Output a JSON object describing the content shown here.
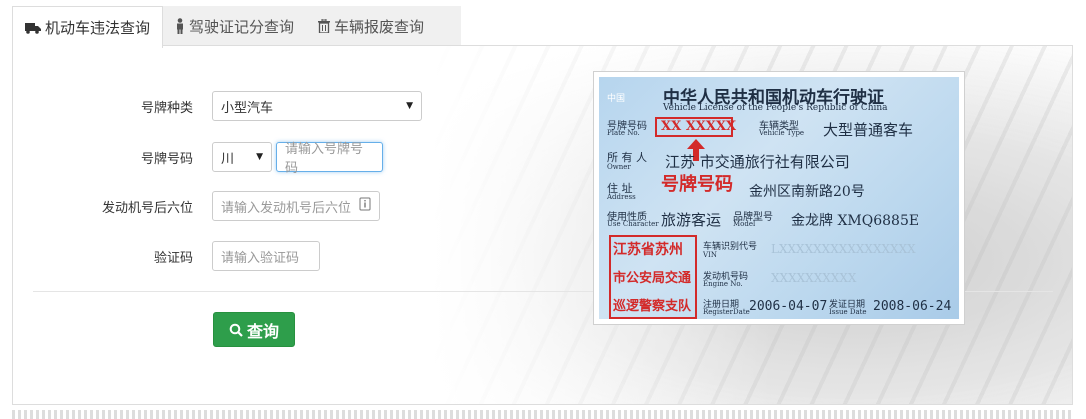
{
  "tabs": [
    {
      "label": "机动车违法查询",
      "icon": "truck-icon",
      "active": true
    },
    {
      "label": "驾驶证记分查询",
      "icon": "person-icon",
      "active": false
    },
    {
      "label": "车辆报废查询",
      "icon": "trash-icon",
      "active": false
    }
  ],
  "form": {
    "plate_type": {
      "label": "号牌种类",
      "value": "小型汽车"
    },
    "plate_number": {
      "label": "号牌号码",
      "province": "川",
      "placeholder": "请输入号牌号码"
    },
    "engine": {
      "label": "发动机号后六位",
      "placeholder": "请输入发动机号后六位"
    },
    "captcha": {
      "label": "验证码",
      "placeholder": "请输入验证码"
    },
    "submit_label": "查询"
  },
  "license": {
    "country": "中国",
    "title_cn": "中华人民共和国机动车行驶证",
    "title_en": "Vehicle License of the People's Republic of China",
    "plate_label": "号牌号码",
    "plate_label_en": "Plate No.",
    "plate_value": "XX XXXXX",
    "vehicle_type_label": "车辆类型",
    "vehicle_type_en": "Vehicle Type",
    "vehicle_type": "大型普通客车",
    "owner_label": "所 有 人",
    "owner_en": "Owner",
    "owner_value": "江苏 市交通旅行社有限公司",
    "address_label": "住 址",
    "address_en": "Address",
    "address_value": "金州区南新路20号",
    "use_label": "使用性质",
    "use_en": "Use Character",
    "use_value": "旅游客运",
    "model_label": "品牌型号",
    "model_en": "Model",
    "model_value": "金龙牌 XMQ6885E",
    "vin_label": "车辆识别代号",
    "vin_en": "VIN",
    "vin_value": "LXXXXXXXXXXXXXXXX",
    "engine_label": "发动机号码",
    "engine_en": "Engine No.",
    "engine_value": "XXXXXXXXXX",
    "register_label": "注册日期",
    "register_en": "RegisterDate",
    "register_value": "2006-04-07",
    "issue_label": "发证日期",
    "issue_en": "Issue Date",
    "issue_value": "2008-06-24",
    "stamp_line1": "江苏省苏州",
    "stamp_line2": "市公安局交通",
    "stamp_line3": "巡逻警察支队",
    "annotation": "号牌号码"
  },
  "colors": {
    "primary_button": "#2e9e4b",
    "annotation": "#d32a2a",
    "focus": "#66afe9"
  }
}
